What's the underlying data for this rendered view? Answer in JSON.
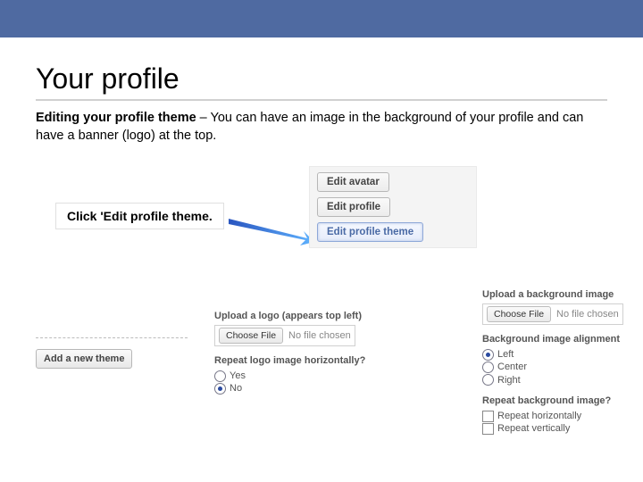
{
  "header": {
    "title": "Your profile"
  },
  "description": {
    "lead": "Editing your profile theme",
    "rest": " – You can have an image in the background of your profile and can have a banner (logo) at the top."
  },
  "callout": {
    "text": "Click 'Edit profile theme."
  },
  "profile_buttons": {
    "edit_avatar": "Edit avatar",
    "edit_profile": "Edit profile",
    "edit_theme": "Edit profile theme"
  },
  "add_theme": {
    "button": "Add a new theme"
  },
  "upload_logo": {
    "label": "Upload a logo (appears top left)",
    "choose_file": "Choose File",
    "no_file": "No file chosen",
    "repeat_label": "Repeat logo image horizontally?",
    "yes": "Yes",
    "no": "No"
  },
  "bg_image": {
    "label": "Upload a background image",
    "choose_file": "Choose File",
    "no_file": "No file chosen",
    "alignment_label": "Background image alignment",
    "align_left": "Left",
    "align_center": "Center",
    "align_right": "Right",
    "repeat_label": "Repeat background image?",
    "repeat_h": "Repeat horizontally",
    "repeat_v": "Repeat vertically"
  }
}
